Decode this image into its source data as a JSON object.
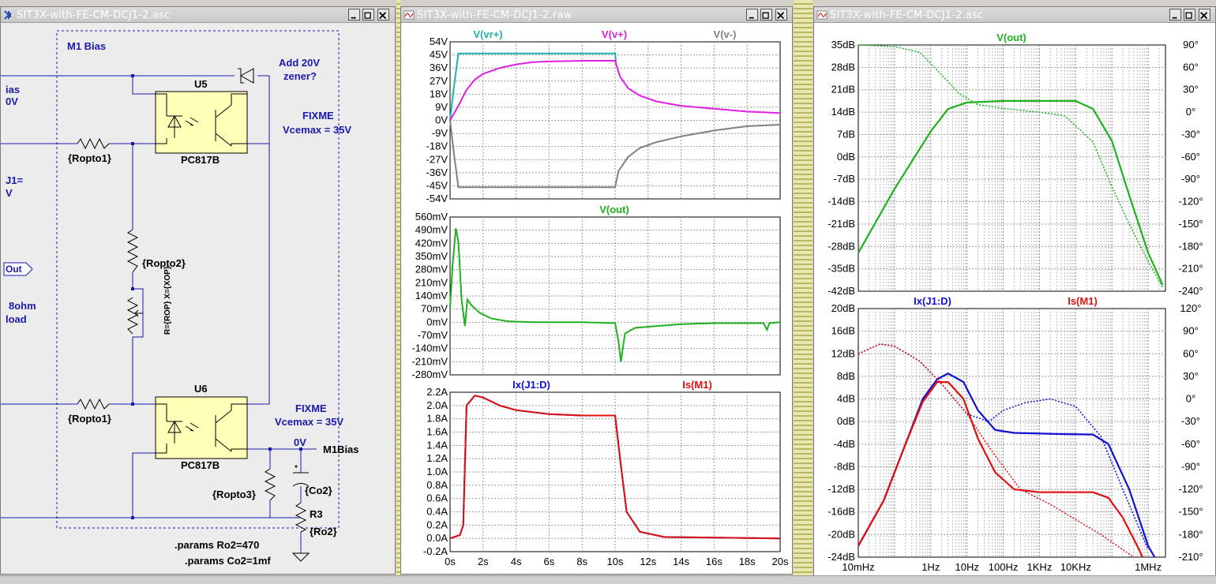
{
  "windows": {
    "schematic": {
      "title": "SIT3X-with-FE-CM-DCJ1-2.asc"
    },
    "transient": {
      "title": "SIT3X-with-FE-CM-DCJ1-2.raw"
    },
    "ac": {
      "title": "SIT3X-with-FE-CM-DCJ1-2.asc"
    }
  },
  "schematic": {
    "bias_box_title": "M1 Bias",
    "left_labels": [
      "ias",
      "0V",
      "J1=",
      "V",
      "Out",
      "8ohm",
      "load"
    ],
    "u5": {
      "ref": "U5",
      "part": "PC817B"
    },
    "u6": {
      "ref": "U6",
      "part": "PC817B"
    },
    "r_opto1_a": "{Ropto1}",
    "r_opto1_b": "{Ropto1}",
    "r_opto2": "{Ropto2}",
    "pot_label": "R={ROP} X={XOP}",
    "r_opto3": "{Ropto3}",
    "c_label": "{Co2}",
    "r3_ref": "R3",
    "r3_val": "{Ro2}",
    "zener_note": [
      "Add 20V",
      "zener?"
    ],
    "fixme1": [
      "FIXME",
      "Vcemax = 35V"
    ],
    "fixme2": [
      "FIXME",
      "Vcemax = 35V"
    ],
    "node_voltage": "0V",
    "net_label": "M1Bias",
    "param1": ".params Ro2=470",
    "param2": ".params Co2=1mf"
  },
  "colors": {
    "cyan": "#1fb0b0",
    "magenta": "#e020e0",
    "gray": "#808080",
    "green": "#20b020",
    "blue": "#1010d0",
    "red": "#e01010",
    "netlabel_blue": "#1a1aaa"
  },
  "chart_data": [
    {
      "type": "line",
      "title": "",
      "legend": [
        "V(vr+)",
        "V(v+)",
        "V(v-)"
      ],
      "x_ticks": [
        "0s",
        "2s",
        "4s",
        "6s",
        "8s",
        "10s",
        "12s",
        "14s",
        "16s",
        "18s",
        "20s"
      ],
      "y_ticks": [
        "54V",
        "45V",
        "36V",
        "27V",
        "18V",
        "9V",
        "0V",
        "-9V",
        "-18V",
        "-27V",
        "-36V",
        "-45V",
        "-54V"
      ],
      "xlim": [
        0,
        20
      ],
      "ylim": [
        -54,
        54
      ],
      "series": [
        {
          "name": "V(vr+)",
          "color": "#1fb0b0",
          "points": [
            [
              0,
              0
            ],
            [
              0.2,
              20
            ],
            [
              0.5,
              46
            ],
            [
              10,
              46
            ],
            [
              10.05,
              40
            ]
          ]
        },
        {
          "name": "V(v+)",
          "color": "#e020e0",
          "points": [
            [
              0,
              0
            ],
            [
              0.5,
              10
            ],
            [
              1,
              21
            ],
            [
              1.5,
              28
            ],
            [
              2,
              32
            ],
            [
              3,
              36
            ],
            [
              4,
              38.5
            ],
            [
              5,
              40
            ],
            [
              6,
              40.5
            ],
            [
              8,
              41
            ],
            [
              10,
              41
            ],
            [
              10.3,
              30
            ],
            [
              10.8,
              22
            ],
            [
              11.5,
              17
            ],
            [
              12.5,
              13
            ],
            [
              14,
              10
            ],
            [
              16,
              8
            ],
            [
              18,
              6
            ],
            [
              20,
              5
            ]
          ]
        },
        {
          "name": "V(v-)",
          "color": "#808080",
          "points": [
            [
              0,
              0
            ],
            [
              0.2,
              -20
            ],
            [
              0.5,
              -46
            ],
            [
              10,
              -46
            ],
            [
              10.2,
              -35
            ],
            [
              10.8,
              -25
            ],
            [
              11.5,
              -19
            ],
            [
              12.5,
              -15
            ],
            [
              14,
              -11
            ],
            [
              16,
              -7
            ],
            [
              18,
              -4
            ],
            [
              20,
              -3
            ]
          ]
        }
      ]
    },
    {
      "type": "line",
      "legend": [
        "V(out)"
      ],
      "x_ticks": [
        "0s",
        "2s",
        "4s",
        "6s",
        "8s",
        "10s",
        "12s",
        "14s",
        "16s",
        "18s",
        "20s"
      ],
      "y_ticks": [
        "560mV",
        "490mV",
        "420mV",
        "350mV",
        "280mV",
        "210mV",
        "140mV",
        "70mV",
        "0mV",
        "-70mV",
        "-140mV",
        "-210mV",
        "-280mV"
      ],
      "xlim": [
        0,
        20
      ],
      "ylim": [
        -280,
        560
      ],
      "series": [
        {
          "name": "V(out)",
          "color": "#20b020",
          "points": [
            [
              0,
              80
            ],
            [
              0.15,
              300
            ],
            [
              0.35,
              500
            ],
            [
              0.5,
              430
            ],
            [
              0.7,
              120
            ],
            [
              0.9,
              -20
            ],
            [
              1.05,
              120
            ],
            [
              1.3,
              90
            ],
            [
              1.8,
              50
            ],
            [
              2.5,
              20
            ],
            [
              3.5,
              5
            ],
            [
              5,
              0
            ],
            [
              8,
              0
            ],
            [
              10,
              -5
            ],
            [
              10.2,
              -100
            ],
            [
              10.35,
              -210
            ],
            [
              10.6,
              -60
            ],
            [
              11.2,
              -30
            ],
            [
              12.5,
              -20
            ],
            [
              14,
              -10
            ],
            [
              16,
              -5
            ],
            [
              19,
              -5
            ],
            [
              19.2,
              -40
            ],
            [
              19.35,
              -5
            ],
            [
              20,
              0
            ]
          ]
        }
      ]
    },
    {
      "type": "line",
      "legend": [
        "Ix(J1:D)",
        "Is(M1)"
      ],
      "x_ticks": [
        "0s",
        "2s",
        "4s",
        "6s",
        "8s",
        "10s",
        "12s",
        "14s",
        "16s",
        "18s",
        "20s"
      ],
      "y_ticks": [
        "2.2A",
        "2.0A",
        "1.8A",
        "1.6A",
        "1.4A",
        "1.2A",
        "1.0A",
        "0.8A",
        "0.6A",
        "0.4A",
        "0.2A",
        "0.0A",
        "-0.2A"
      ],
      "xlim": [
        0,
        20
      ],
      "ylim": [
        -0.2,
        2.2
      ],
      "series": [
        {
          "name": "Ix(J1:D)",
          "color": "#1010d0",
          "points": [
            [
              0,
              0
            ],
            [
              0.6,
              0.05
            ],
            [
              0.8,
              0.2
            ],
            [
              1.0,
              2.0
            ],
            [
              1.5,
              2.15
            ],
            [
              2,
              2.12
            ],
            [
              3,
              2.0
            ],
            [
              4,
              1.93
            ],
            [
              6,
              1.87
            ],
            [
              8,
              1.85
            ],
            [
              10,
              1.85
            ],
            [
              10.3,
              1.2
            ],
            [
              10.7,
              0.4
            ],
            [
              11.5,
              0.1
            ],
            [
              13,
              0.02
            ],
            [
              20,
              0
            ]
          ]
        },
        {
          "name": "Is(M1)",
          "color": "#e01010",
          "points": [
            [
              0,
              0
            ],
            [
              0.6,
              0.05
            ],
            [
              0.8,
              0.2
            ],
            [
              1.0,
              2.0
            ],
            [
              1.5,
              2.15
            ],
            [
              2,
              2.12
            ],
            [
              3,
              2.0
            ],
            [
              4,
              1.93
            ],
            [
              6,
              1.87
            ],
            [
              8,
              1.85
            ],
            [
              10,
              1.85
            ],
            [
              10.3,
              1.2
            ],
            [
              10.7,
              0.4
            ],
            [
              11.5,
              0.1
            ],
            [
              13,
              0.02
            ],
            [
              20,
              0
            ]
          ]
        }
      ]
    },
    {
      "type": "line",
      "legend": [
        "V(out)"
      ],
      "x_scale": "log",
      "xlim": [
        0.01,
        3000000
      ],
      "ylim_db": [
        -42,
        35
      ],
      "ylim_phase": [
        -240,
        90
      ],
      "y_ticks_left": [
        "35dB",
        "28dB",
        "21dB",
        "14dB",
        "7dB",
        "0dB",
        "-7dB",
        "-14dB",
        "-21dB",
        "-28dB",
        "-35dB",
        "-42dB"
      ],
      "y_ticks_right": [
        "90°",
        "60°",
        "30°",
        "0°",
        "-30°",
        "-60°",
        "-90°",
        "-120°",
        "-150°",
        "-180°",
        "-210°",
        "-240°"
      ],
      "series": [
        {
          "name": "V(out) magnitude",
          "color": "#20b020",
          "points": [
            [
              0.01,
              -30
            ],
            [
              0.1,
              -10
            ],
            [
              1,
              8
            ],
            [
              3,
              15
            ],
            [
              10,
              17
            ],
            [
              100,
              17.5
            ],
            [
              10000,
              17.5
            ],
            [
              30000,
              15
            ],
            [
              100000,
              5
            ],
            [
              300000,
              -12
            ],
            [
              1000000,
              -30
            ],
            [
              2500000,
              -40
            ]
          ]
        },
        {
          "name": "V(out) phase",
          "color": "#20b020",
          "dashed": true,
          "points": [
            [
              0.01,
              90
            ],
            [
              0.1,
              88
            ],
            [
              0.5,
              80
            ],
            [
              2,
              50
            ],
            [
              6,
              25
            ],
            [
              20,
              10
            ],
            [
              100,
              5
            ],
            [
              1000,
              0
            ],
            [
              5000,
              -5
            ],
            [
              30000,
              -40
            ],
            [
              100000,
              -100
            ],
            [
              300000,
              -150
            ],
            [
              1000000,
              -200
            ],
            [
              2500000,
              -235
            ]
          ]
        }
      ]
    },
    {
      "type": "line",
      "legend": [
        "Ix(J1:D)",
        "Is(M1)"
      ],
      "x_scale": "log",
      "x_ticks": [
        "10mHz",
        "1Hz",
        "10Hz",
        "100Hz",
        "1KHz",
        "10KHz",
        "1MHz"
      ],
      "xlim": [
        0.01,
        3000000
      ],
      "ylim_db": [
        -24,
        20
      ],
      "ylim_phase": [
        -210,
        120
      ],
      "y_ticks_left": [
        "20dB",
        "16dB",
        "12dB",
        "8dB",
        "4dB",
        "0dB",
        "-4dB",
        "-8dB",
        "-12dB",
        "-16dB",
        "-20dB",
        "-24dB"
      ],
      "y_ticks_right": [
        "120°",
        "90°",
        "60°",
        "30°",
        "0°",
        "-30°",
        "-60°",
        "-90°",
        "-120°",
        "-150°",
        "-180°",
        "-210°"
      ],
      "series": [
        {
          "name": "Ix(J1:D) magnitude",
          "color": "#1010d0",
          "points": [
            [
              0.01,
              -22
            ],
            [
              0.05,
              -14
            ],
            [
              0.2,
              -4
            ],
            [
              0.6,
              4
            ],
            [
              1.5,
              7.5
            ],
            [
              3,
              8.5
            ],
            [
              8,
              7
            ],
            [
              20,
              2
            ],
            [
              60,
              -1.5
            ],
            [
              200,
              -2
            ],
            [
              3000,
              -2.2
            ],
            [
              30000,
              -2.3
            ],
            [
              80000,
              -4
            ],
            [
              300000,
              -12
            ],
            [
              1000000,
              -22
            ],
            [
              1500000,
              -24
            ]
          ]
        },
        {
          "name": "Is(M1) magnitude",
          "color": "#e01010",
          "points": [
            [
              0.01,
              -22
            ],
            [
              0.05,
              -14
            ],
            [
              0.2,
              -4
            ],
            [
              0.6,
              3.5
            ],
            [
              1.5,
              7
            ],
            [
              3,
              7
            ],
            [
              8,
              4
            ],
            [
              20,
              -3
            ],
            [
              60,
              -9
            ],
            [
              200,
              -12
            ],
            [
              1000,
              -12.5
            ],
            [
              30000,
              -12.5
            ],
            [
              80000,
              -13.5
            ],
            [
              200000,
              -17
            ],
            [
              500000,
              -22
            ],
            [
              700000,
              -24
            ]
          ]
        },
        {
          "name": "Ix(J1:D) phase",
          "color": "#1010d0",
          "dashed": true,
          "points": [
            [
              0.01,
              60
            ],
            [
              0.04,
              73
            ],
            [
              0.1,
              70
            ],
            [
              0.5,
              50
            ],
            [
              2,
              20
            ],
            [
              10,
              -20
            ],
            [
              40,
              -30
            ],
            [
              100,
              -15
            ],
            [
              400,
              -5
            ],
            [
              2000,
              0
            ],
            [
              10000,
              -10
            ],
            [
              50000,
              -50
            ],
            [
              200000,
              -120
            ],
            [
              1000000,
              -200
            ]
          ]
        },
        {
          "name": "Is(M1) phase",
          "color": "#e01010",
          "dashed": true,
          "points": [
            [
              0.01,
              60
            ],
            [
              0.04,
              73
            ],
            [
              0.1,
              70
            ],
            [
              0.5,
              50
            ],
            [
              2,
              20
            ],
            [
              10,
              -20
            ],
            [
              50,
              -70
            ],
            [
              300,
              -120
            ],
            [
              2000,
              -140
            ],
            [
              10000,
              -160
            ],
            [
              50000,
              -180
            ],
            [
              200000,
              -200
            ],
            [
              400000,
              -210
            ]
          ]
        }
      ]
    }
  ]
}
